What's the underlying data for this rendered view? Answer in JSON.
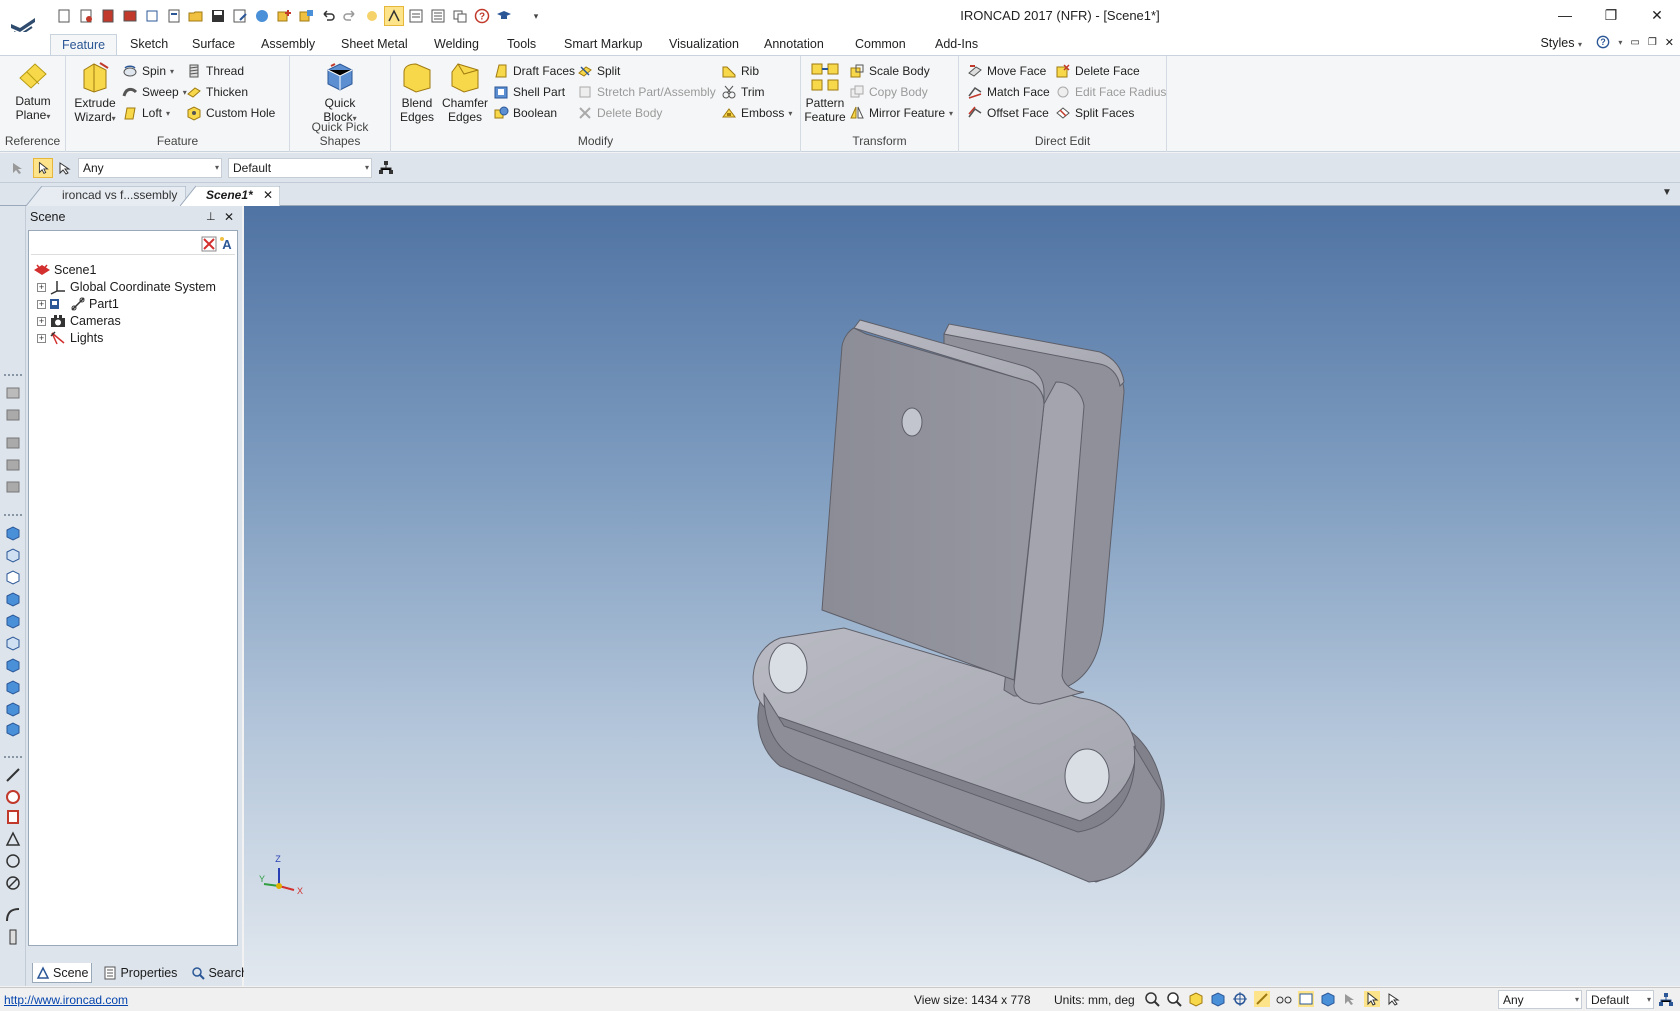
{
  "window": {
    "title": "IRONCAD 2017 (NFR) - [Scene1*]"
  },
  "ribbon_tabs": [
    "Feature",
    "Sketch",
    "Surface",
    "Assembly",
    "Sheet Metal",
    "Welding",
    "Tools",
    "Smart Markup",
    "Visualization",
    "Annotation",
    "Common",
    "Add-Ins"
  ],
  "styles_label": "Styles",
  "groups": {
    "reference": {
      "label": "Reference",
      "datum_plane": "Datum Plane"
    },
    "feature": {
      "label": "Feature",
      "extrude_wizard": "Extrude Wizard",
      "spin": "Spin",
      "sweep": "Sweep",
      "loft": "Loft",
      "thread": "Thread",
      "thicken": "Thicken",
      "custom_hole": "Custom Hole"
    },
    "quick_pick": {
      "label": "Quick Pick Shapes",
      "quick_block": "Quick Block"
    },
    "modify": {
      "label": "Modify",
      "blend_edges": "Blend Edges",
      "chamfer_edges": "Chamfer Edges",
      "draft_faces": "Draft Faces",
      "shell_part": "Shell Part",
      "boolean": "Boolean",
      "split": "Split",
      "stretch": "Stretch Part/Assembly",
      "delete_body": "Delete Body",
      "rib": "Rib",
      "trim": "Trim",
      "emboss": "Emboss"
    },
    "transform": {
      "label": "Transform",
      "pattern_feature": "Pattern Feature",
      "scale_body": "Scale Body",
      "copy_body": "Copy Body",
      "mirror_feature": "Mirror Feature"
    },
    "direct_edit": {
      "label": "Direct Edit",
      "move_face": "Move Face",
      "match_face": "Match Face",
      "offset_face": "Offset Face",
      "delete_face": "Delete Face",
      "edit_face_radius": "Edit Face Radius",
      "split_faces": "Split Faces"
    }
  },
  "selection": {
    "filter": "Any",
    "style": "Default"
  },
  "doc_tabs": [
    {
      "label": "ironcad vs f...ssembly"
    },
    {
      "label": "Scene1*"
    }
  ],
  "scene_panel": {
    "title": "Scene",
    "tree": [
      "Scene1",
      "Global Coordinate System",
      "Part1",
      "Cameras",
      "Lights"
    ],
    "tabs": [
      "Scene",
      "Properties",
      "Search"
    ]
  },
  "triad": {
    "z": "Z",
    "y": "Y",
    "x": "X"
  },
  "status": {
    "link": "http://www.ironcad.com",
    "view_size": "View size: 1434 x  778",
    "units": "Units: mm, deg",
    "filter": "Any",
    "style": "Default"
  },
  "colors": {
    "accent": "#2b5797",
    "viewport_top": "#4f73a3",
    "viewport_bottom": "#e2e8ef",
    "part": "#8e8f98"
  }
}
